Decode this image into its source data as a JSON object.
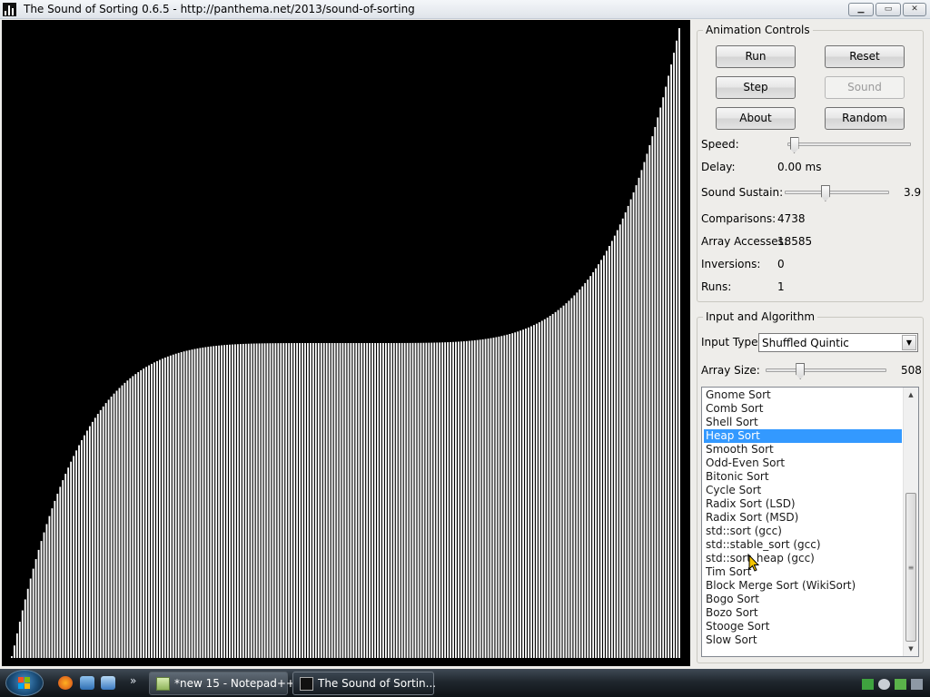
{
  "window": {
    "title": "The Sound of Sorting 0.6.5 - http://panthema.net/2013/sound-of-sorting",
    "controls": {
      "minimize": "▁",
      "maximize": "▭",
      "close": "✕"
    }
  },
  "visualization": {
    "bar_count": 249,
    "description_values": "shuffled quintic input partially sorted by heap sort",
    "bar_color": "#ffffff",
    "background": "#000000"
  },
  "animation_controls": {
    "legend": "Animation Controls",
    "buttons": {
      "run": "Run",
      "reset": "Reset",
      "step": "Step",
      "sound": "Sound",
      "about": "About",
      "random": "Random"
    },
    "speed_label": "Speed:",
    "speed_level": 0.02,
    "delay_label": "Delay:",
    "delay_value": "0.00 ms",
    "sound_sustain_label": "Sound Sustain:",
    "sound_sustain_value": "3.9",
    "sound_sustain_level": 0.38,
    "comparisons_label": "Comparisons:",
    "comparisons_value": "4738",
    "array_accesses_label": "Array Accesses:",
    "array_accesses_value": "18585",
    "inversions_label": "Inversions:",
    "inversions_value": "0",
    "runs_label": "Runs:",
    "runs_value": "1"
  },
  "input_algorithm": {
    "legend": "Input and Algorithm",
    "input_type_label": "Input Type:",
    "input_type_value": "Shuffled Quintic",
    "array_size_label": "Array Size:",
    "array_size_value": "508",
    "array_size_level": 0.27,
    "algorithms": [
      "Gnome Sort",
      "Comb Sort",
      "Shell Sort",
      "Heap Sort",
      "Smooth Sort",
      "Odd-Even Sort",
      "Bitonic Sort",
      "Cycle Sort",
      "Radix Sort (LSD)",
      "Radix Sort (MSD)",
      "std::sort (gcc)",
      "std::stable_sort (gcc)",
      "std::sort_heap (gcc)",
      "Tim Sort",
      "Block Merge Sort (WikiSort)",
      "Bogo Sort",
      "Bozo Sort",
      "Stooge Sort",
      "Slow Sort"
    ],
    "selected_algorithm": "Heap Sort"
  },
  "taskbar": {
    "items": [
      {
        "label": "*new 15 - Notepad++",
        "icon": "notepad-icon"
      },
      {
        "label": "The Sound of Sortin...",
        "icon": "sound-of-sorting-icon"
      }
    ],
    "quick_launch": [
      "firefox-icon",
      "show-desktop-icon",
      "switch-windows-icon"
    ],
    "chevron": "»"
  },
  "colors": {
    "selection": "#3399ff",
    "panel_bg": "#eeedea",
    "taskbar": "#20272e"
  }
}
